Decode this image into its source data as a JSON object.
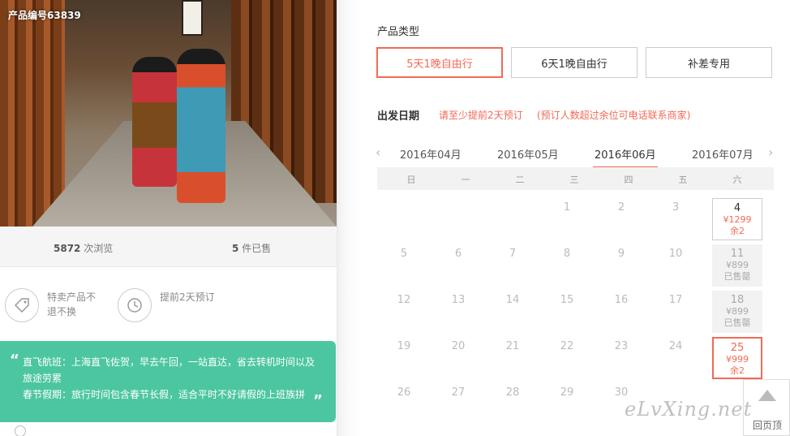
{
  "product": {
    "code": "产品编号63839",
    "views_num": "5872",
    "views_label": "次浏览",
    "sold_num": "5",
    "sold_label": "件已售"
  },
  "features": [
    {
      "icon": "tag-icon",
      "text": "特卖产品不退不换"
    },
    {
      "icon": "history-clock-icon",
      "text": "提前2天预订"
    }
  ],
  "notice": {
    "line1": "直飞航班：上海直飞佐贺，早去午回，一站直达，省去转机时间以及旅途劳累",
    "line2": "春节假期：旅行时间包含春节长假，适合平时不好请假的上班族拼"
  },
  "booking": {
    "type_label": "产品类型",
    "types": [
      "5天1晚自由行",
      "6天1晚自由行",
      "补差专用"
    ],
    "date_label": "出发日期",
    "hint1": "请至少提前2天预订",
    "hint2": "(预订人数超过余位可电话联系商家)",
    "months": [
      "2016年04月",
      "2016年05月",
      "2016年06月",
      "2016年07月"
    ],
    "weekdays": [
      "日",
      "一",
      "二",
      "三",
      "四",
      "五",
      "六"
    ],
    "days": [
      {
        "d": "1"
      },
      {
        "d": "2"
      },
      {
        "d": "3"
      },
      {
        "d": "4",
        "price": "¥1299",
        "rem": "余2",
        "state": "avail"
      },
      {
        "d": "5"
      },
      {
        "d": "6"
      },
      {
        "d": "7"
      },
      {
        "d": "8"
      },
      {
        "d": "9"
      },
      {
        "d": "10"
      },
      {
        "d": "11",
        "price": "¥899",
        "rem": "已售罄",
        "state": "sold"
      },
      {
        "d": "12"
      },
      {
        "d": "13"
      },
      {
        "d": "14"
      },
      {
        "d": "15"
      },
      {
        "d": "16"
      },
      {
        "d": "17"
      },
      {
        "d": "18",
        "price": "¥899",
        "rem": "已售罄",
        "state": "sold"
      },
      {
        "d": "19"
      },
      {
        "d": "20"
      },
      {
        "d": "21"
      },
      {
        "d": "22"
      },
      {
        "d": "23"
      },
      {
        "d": "24"
      },
      {
        "d": "25",
        "price": "¥999",
        "rem": "余2",
        "state": "selected"
      },
      {
        "d": "26"
      },
      {
        "d": "27"
      },
      {
        "d": "28"
      },
      {
        "d": "29"
      },
      {
        "d": "30"
      }
    ]
  },
  "back_to_top": "回页顶",
  "watermark": "eLvXing.net",
  "colors": {
    "accent": "#f06a57",
    "notice": "#4cc6a0"
  }
}
